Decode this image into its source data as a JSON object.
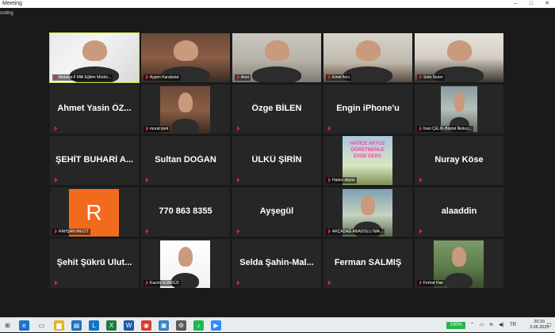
{
  "window": {
    "title": "Meeting",
    "minimize_icon": "minimize-icon",
    "maximize_icon": "maximize-icon",
    "close_icon": "close-icon"
  },
  "recording_label": "ording",
  "tiles": [
    {
      "kind": "video",
      "name": "Malatya İl Milli Eğitim Müdür...",
      "muted": true,
      "active": true
    },
    {
      "kind": "video",
      "name": "Ayşen Karabulut",
      "muted": true
    },
    {
      "kind": "video",
      "name": "Acer",
      "muted": true
    },
    {
      "kind": "video",
      "name": "Emel Avcı",
      "muted": true
    },
    {
      "kind": "video",
      "name": "Sefa Sezer",
      "muted": true
    },
    {
      "kind": "name",
      "name": "Ahmet Yasin ÖZ...",
      "muted": true
    },
    {
      "kind": "video",
      "name": "murat ipek",
      "muted": true
    },
    {
      "kind": "name",
      "name": "Özge BİLEN",
      "muted": true
    },
    {
      "kind": "name",
      "name": "Engin iPhone'u",
      "muted": true
    },
    {
      "kind": "video",
      "name": "İnan ÇELİK-Bindal İlkokul...",
      "muted": true
    },
    {
      "kind": "name",
      "name": "ŞEHİT BUHARİ A...",
      "muted": true
    },
    {
      "kind": "name",
      "name": "Sultan DOĞAN",
      "muted": true
    },
    {
      "kind": "name",
      "name": "ÜLKÜ ŞİRİN",
      "muted": true
    },
    {
      "kind": "video",
      "name": "Hatice akyüz",
      "muted": true,
      "poster_text": "HATİCE AKYÜZ ÖĞRETMENLE EVDE DERS"
    },
    {
      "kind": "name",
      "name": "Nuray Köse",
      "muted": true
    },
    {
      "kind": "avatar",
      "name": "RAHŞAN MECİT",
      "muted": true,
      "avatar_letter": "R"
    },
    {
      "kind": "name",
      "name": "770 863 8355",
      "muted": true
    },
    {
      "kind": "name",
      "name": "Ayşegül",
      "muted": true
    },
    {
      "kind": "video",
      "name": "AKÇADAĞ ANADOLU İMA...",
      "muted": true
    },
    {
      "kind": "name",
      "name": "alaaddin",
      "muted": true
    },
    {
      "kind": "name",
      "name": "Şehit Şükrü Ulut...",
      "muted": true
    },
    {
      "kind": "video",
      "name": "Kazım GÜNDÜZ",
      "muted": true
    },
    {
      "kind": "name",
      "name": "Selda Şahin-Mal...",
      "muted": true
    },
    {
      "kind": "name",
      "name": "Ferman SALMIŞ",
      "muted": true
    },
    {
      "kind": "video",
      "name": "Ferhat Han",
      "muted": true
    }
  ],
  "taskbar": {
    "battery": "100%",
    "time": "20:20",
    "date": "3.06.2020",
    "apps": [
      "task-view",
      "edge",
      "file-explorer",
      "store",
      "mail",
      "lync",
      "excel",
      "word",
      "chrome",
      "photos",
      "settings",
      "spotify",
      "zoom-meetings",
      "zoom"
    ]
  },
  "colors": {
    "active_border": "#c6e23a",
    "muted_mic": "#e0282e",
    "avatar_bg": "#f26b1d"
  }
}
